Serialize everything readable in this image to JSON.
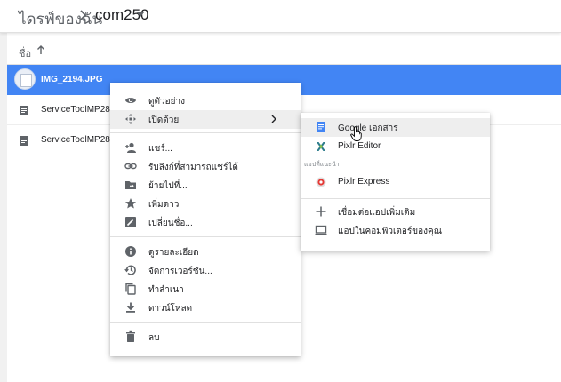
{
  "breadcrumb": {
    "root": "ไดรฟ์ของฉัน",
    "current": "com250"
  },
  "list": {
    "sort_column": "ชื่อ",
    "rows": [
      {
        "name": "IMG_2194.JPG",
        "selected": true
      },
      {
        "name": "ServiceToolMP287V"
      },
      {
        "name": "ServiceToolMP287.z"
      }
    ]
  },
  "context_menu": {
    "items": [
      {
        "label": "ดูตัวอย่าง",
        "icon": "eye-icon"
      },
      {
        "label": "เปิดด้วย",
        "icon": "open-with-icon",
        "has_submenu": true
      },
      {
        "label": "แชร์...",
        "icon": "share-person-icon"
      },
      {
        "label": "รับลิงก์ที่สามารถแชร์ได้",
        "icon": "link-icon"
      },
      {
        "label": "ย้ายไปที่...",
        "icon": "move-folder-icon"
      },
      {
        "label": "เพิ่มดาว",
        "icon": "star-icon"
      },
      {
        "label": "เปลี่ยนชื่อ...",
        "icon": "rename-icon"
      },
      {
        "label": "ดูรายละเอียด",
        "icon": "info-icon"
      },
      {
        "label": "จัดการเวอร์ชัน...",
        "icon": "history-icon"
      },
      {
        "label": "ทำสำเนา",
        "icon": "copy-icon"
      },
      {
        "label": "ดาวน์โหลด",
        "icon": "download-icon"
      },
      {
        "label": "ลบ",
        "icon": "trash-icon"
      }
    ]
  },
  "open_with_menu": {
    "items": [
      {
        "label": "Google เอกสาร",
        "icon": "google-docs-icon"
      },
      {
        "label": "Pixlr Editor",
        "icon": "pixlr-editor-icon"
      }
    ],
    "suggested_header": "แอปที่แนะนำ",
    "suggested": [
      {
        "label": "Pixlr Express",
        "icon": "pixlr-express-icon"
      }
    ],
    "extra": [
      {
        "label": "เชื่อมต่อแอปเพิ่มเติม",
        "icon": "plus-icon"
      },
      {
        "label": "แอปในคอมพิวเตอร์ของคุณ",
        "icon": "computer-icon"
      }
    ]
  },
  "colors": {
    "selected_row": "#4285f4",
    "menu_hover": "#eeeeee",
    "icon_gray": "#5f6368"
  }
}
